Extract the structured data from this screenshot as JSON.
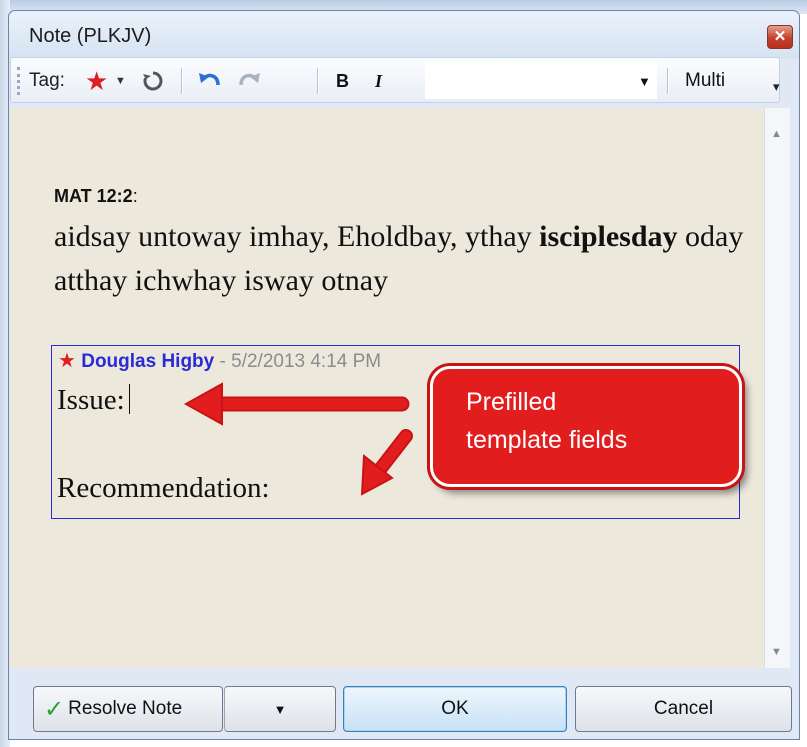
{
  "window": {
    "title": "Note (PLKJV)",
    "close_glyph": "✕"
  },
  "toolbar": {
    "tag_label": "Tag:",
    "tag_icon": "star-icon",
    "bold_label": "B",
    "italic_label": "I",
    "font_value": "",
    "multi_label": "Multi"
  },
  "content": {
    "reference": "MAT 12:2",
    "reference_suffix": ":",
    "verse_part1": "aidsay untoway imhay, Eholdbay, ythay",
    "verse_bold": "isciplesday",
    "verse_part2": "oday atthay ichwhay isway otnay"
  },
  "note": {
    "author": "Douglas Higby",
    "separator": " - ",
    "date": "5/2/2013 4:14 PM",
    "field_issue": "Issue:",
    "field_recommendation": "Recommendation:"
  },
  "callout": {
    "line1": "Prefilled",
    "line2": "template fields"
  },
  "buttons": {
    "resolve_label": "Resolve Note",
    "ok_label": "OK",
    "cancel_label": "Cancel"
  },
  "colors": {
    "accent_red": "#e21d1d",
    "note_border": "#2a2ad6",
    "editor_bg": "#ece9dc"
  }
}
